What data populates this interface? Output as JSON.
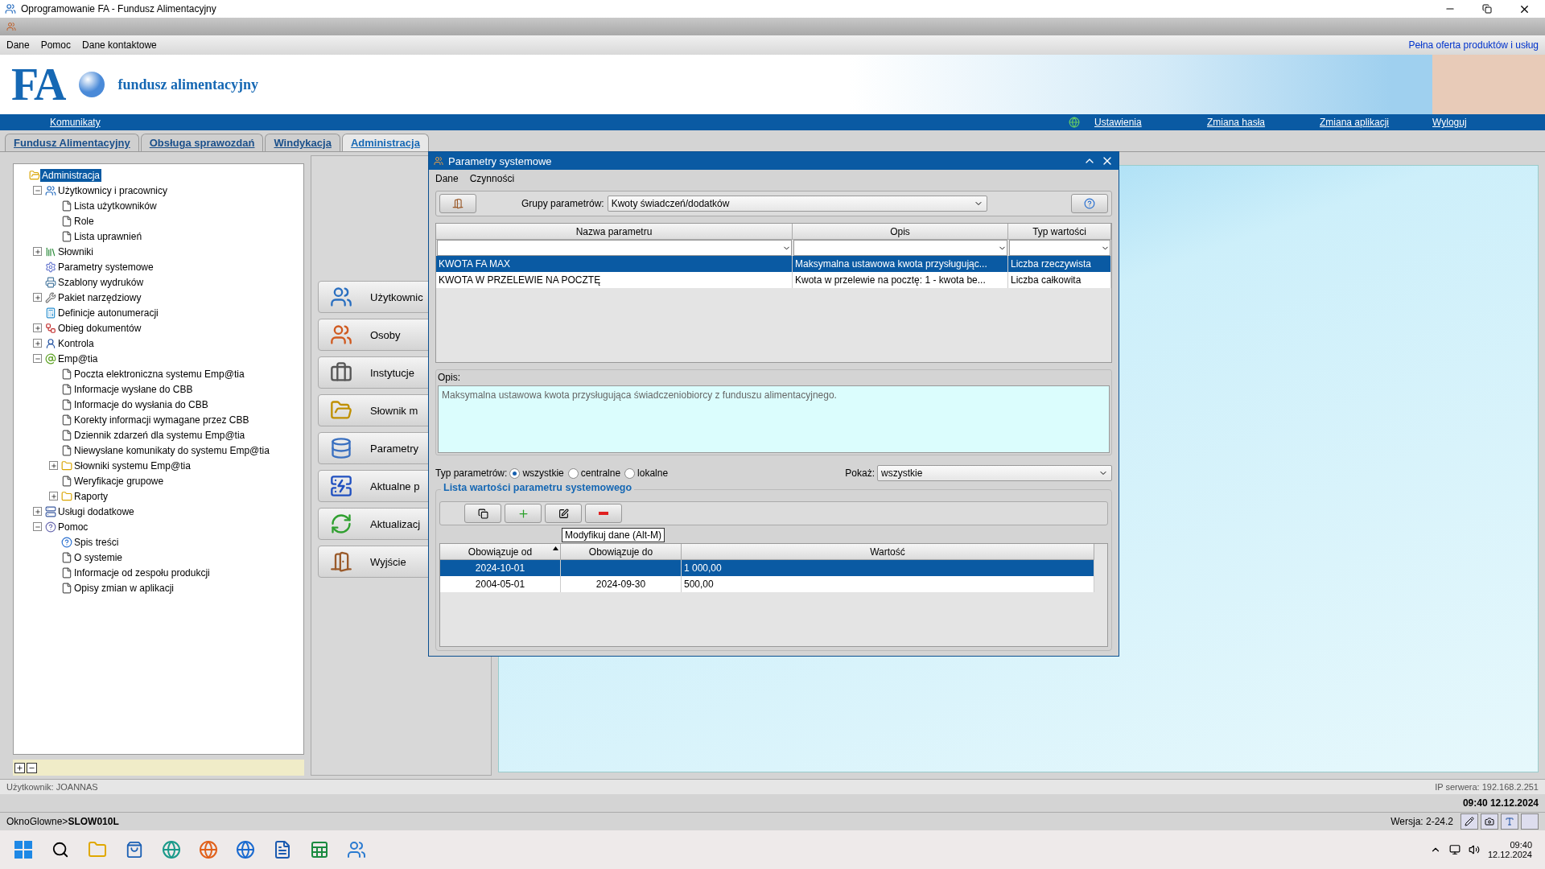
{
  "window": {
    "title": "Oprogramowanie FA - Fundusz Alimentacyjny"
  },
  "menu": [
    "Dane",
    "Pomoc",
    "Dane kontaktowe"
  ],
  "menu_link": "Pełna oferta produktów i usług",
  "banner": {
    "logo": "FA",
    "subtitle": "fundusz alimentacyjny"
  },
  "nav": {
    "left": "Komunikaty",
    "right": [
      "Ustawienia",
      "Zmiana hasła",
      "Zmiana aplikacji",
      "Wyloguj"
    ]
  },
  "tabs": [
    {
      "label": "Fundusz Alimentacyjny",
      "selected": false
    },
    {
      "label": "Obsługa sprawozdań",
      "selected": false
    },
    {
      "label": "Windykacja",
      "selected": false
    },
    {
      "label": "Administracja",
      "selected": true
    }
  ],
  "tree": {
    "label": "Administracja",
    "kind": "openfolder",
    "selected": true,
    "children": [
      {
        "label": "Użytkownicy i pracownicy",
        "kind": "users",
        "selected": false,
        "expanded": true,
        "children": [
          {
            "label": "Lista użytkowników",
            "kind": "page",
            "selected": false
          },
          {
            "label": "Role",
            "kind": "page",
            "selected": false
          },
          {
            "label": "Lista uprawnień",
            "kind": "page",
            "selected": false
          }
        ]
      },
      {
        "label": "Słowniki",
        "kind": "books",
        "selected": false,
        "expanded": false
      },
      {
        "label": "Parametry systemowe",
        "kind": "gears",
        "selected": false
      },
      {
        "label": "Szablony wydruków",
        "kind": "printer",
        "selected": false
      },
      {
        "label": "Pakiet narzędziowy",
        "kind": "wrench",
        "selected": false,
        "expanded": false
      },
      {
        "label": "Definicje autonumeracji",
        "kind": "calculator",
        "selected": false
      },
      {
        "label": "Obieg dokumentów",
        "kind": "flow",
        "selected": false,
        "expanded": false
      },
      {
        "label": "Kontrola",
        "kind": "person",
        "selected": false,
        "expanded": false
      },
      {
        "label": "Emp@tia",
        "kind": "at",
        "selected": false,
        "expanded": true,
        "children": [
          {
            "label": "Poczta elektroniczna systemu Emp@tia",
            "kind": "page",
            "selected": false
          },
          {
            "label": "Informacje wysłane do CBB",
            "kind": "page",
            "selected": false
          },
          {
            "label": "Informacje do wysłania do CBB",
            "kind": "page",
            "selected": false
          },
          {
            "label": "Korekty informacji wymagane przez CBB",
            "kind": "page",
            "selected": false
          },
          {
            "label": "Dziennik zdarzeń dla systemu Emp@tia",
            "kind": "page",
            "selected": false
          },
          {
            "label": "Niewysłane komunikaty do systemu Emp@tia",
            "kind": "page",
            "selected": false
          },
          {
            "label": "Słowniki systemu Emp@tia",
            "kind": "folder",
            "selected": false,
            "expanded": false
          },
          {
            "label": "Weryfikacje grupowe",
            "kind": "page",
            "selected": false
          },
          {
            "label": "Raporty",
            "kind": "folder",
            "selected": false,
            "expanded": false
          }
        ]
      },
      {
        "label": "Usługi dodatkowe",
        "kind": "server",
        "selected": false,
        "expanded": false
      },
      {
        "label": "Pomoc",
        "kind": "help",
        "selected": false,
        "expanded": true,
        "children": [
          {
            "label": "Spis treści",
            "kind": "question",
            "selected": false
          },
          {
            "label": "O systemie",
            "kind": "page",
            "selected": false
          },
          {
            "label": "Informacje od zespołu produkcji",
            "kind": "page",
            "selected": false
          },
          {
            "label": "Opisy zmian w aplikacji",
            "kind": "page",
            "selected": false
          }
        ]
      }
    ]
  },
  "side_buttons": [
    {
      "label": "Użytkownic",
      "kind": "users"
    },
    {
      "label": "Osoby",
      "kind": "people"
    },
    {
      "label": "Instytucje",
      "kind": "briefcase"
    },
    {
      "label": "Słownik m",
      "kind": "folder"
    },
    {
      "label": "Parametry",
      "kind": "database"
    },
    {
      "label": "Aktualne p",
      "kind": "alert"
    },
    {
      "label": "Aktualizacj",
      "kind": "sync"
    },
    {
      "label": "Wyjście",
      "kind": "door"
    }
  ],
  "dialog": {
    "title": "Parametry systemowe",
    "menu": [
      "Dane",
      "Czynności"
    ],
    "group_label": "Grupy parametrów:",
    "group_value": "Kwoty świadczeń/dodatków",
    "table": {
      "columns": [
        "Nazwa parametru",
        "Opis",
        "Typ wartości"
      ],
      "rows": [
        {
          "cells": [
            "KWOTA FA MAX",
            "Maksymalna ustawowa kwota przysługując...",
            "Liczba rzeczywista"
          ],
          "selected": true
        },
        {
          "cells": [
            "KWOTA W PRZELEWIE NA POCZTĘ",
            "Kwota w przelewie na pocztę: 1 - kwota be...",
            "Liczba całkowita"
          ],
          "selected": false
        }
      ]
    },
    "description_label": "Opis:",
    "description": "Maksymalna ustawowa kwota przysługująca świadczeniobiorcy z funduszu alimentacyjnego.",
    "type_label": "Typ parametrów:",
    "types": [
      {
        "label": "wszystkie",
        "selected": true
      },
      {
        "label": "centralne",
        "selected": false
      },
      {
        "label": "lokalne",
        "selected": false
      }
    ],
    "show_label": "Pokaż:",
    "show_value": "wszystkie",
    "values_title": "Lista wartości parametru systemowego",
    "values_table": {
      "columns": [
        "Obowiązuje od",
        "Obowiązuje do",
        "Wartość"
      ],
      "rows": [
        {
          "cells": [
            "2024-10-01",
            "",
            "1 000,00"
          ],
          "selected": true
        },
        {
          "cells": [
            "2004-05-01",
            "2024-09-30",
            "500,00"
          ],
          "selected": false
        }
      ]
    },
    "tooltip": "Modyfikuj dane (Alt-M)"
  },
  "status": {
    "user": "Użytkownik: JOANNAS",
    "server": "IP serwera: 192.168.2.251",
    "datetime": "09:40 12.12.2024",
    "path": "OknoGlowne>**SLOW010L**",
    "version": "Wersja: 2-24.2"
  },
  "taskbar": {
    "time": "09:40",
    "date": "12.12.2024"
  }
}
